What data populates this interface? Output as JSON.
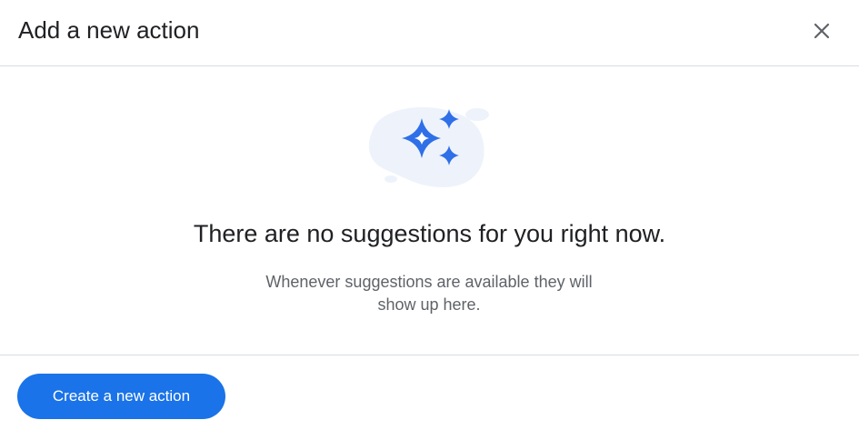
{
  "dialog": {
    "title": "Add a new action",
    "close_icon": "close-icon"
  },
  "empty_state": {
    "illustration_icon": "sparkle-stars-icon",
    "headline": "There are no suggestions for you right now.",
    "subtext": "Whenever suggestions are available they will show up here."
  },
  "footer": {
    "primary_button_label": "Create a new action"
  },
  "colors": {
    "accent": "#1a73e8",
    "sparkle": "#2f6fe8",
    "blob": "#eef3fb",
    "text_primary": "#202124",
    "text_secondary": "#5f6368",
    "divider": "#dadce0"
  }
}
